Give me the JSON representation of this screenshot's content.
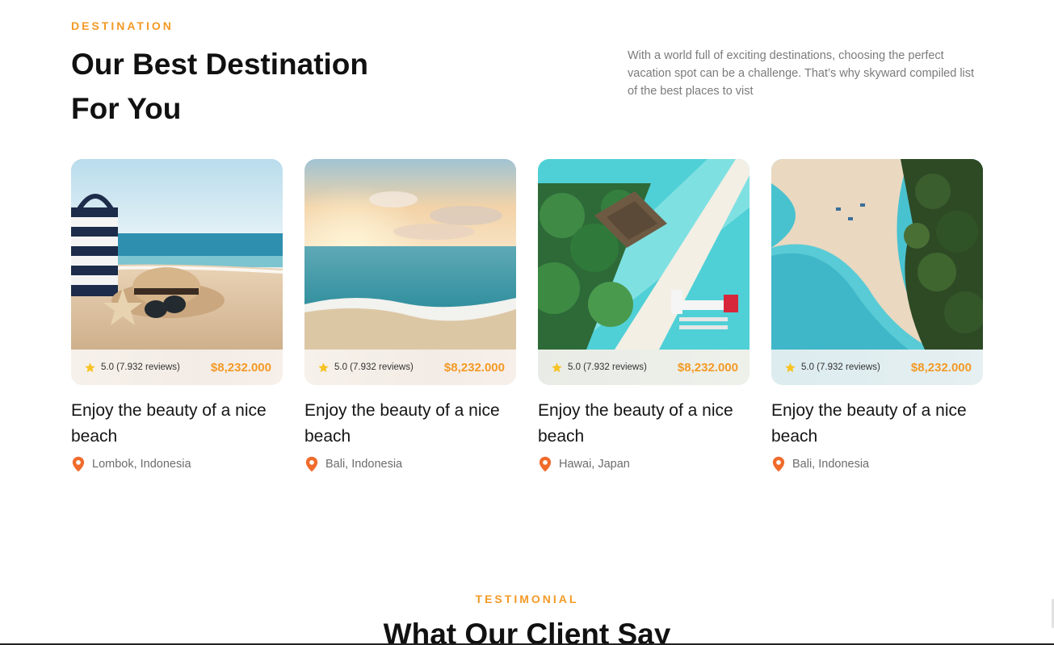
{
  "destination": {
    "eyebrow": "DESTINATION",
    "title": "Our Best Destination For You",
    "description": "With a world full of exciting destinations, choosing the perfect vacation spot can be a challenge. That’s why skyward compiled list of the best places to vist",
    "cards": [
      {
        "rating": "5.0 (7.932 reviews)",
        "price": "$8,232.000",
        "title": "Enjoy the beauty of a nice beach",
        "location": "Lombok, Indonesia"
      },
      {
        "rating": "5.0 (7.932 reviews)",
        "price": "$8,232.000",
        "title": "Enjoy the beauty of a nice beach",
        "location": "Bali, Indonesia"
      },
      {
        "rating": "5.0 (7.932 reviews)",
        "price": "$8,232.000",
        "title": "Enjoy the beauty of a nice beach",
        "location": "Hawai, Japan"
      },
      {
        "rating": "5.0 (7.932 reviews)",
        "price": "$8,232.000",
        "title": "Enjoy the beauty of a nice beach",
        "location": "Bali, Indonesia"
      }
    ]
  },
  "testimonial": {
    "eyebrow": "TESTIMONIAL",
    "title": "What Our Client Say"
  },
  "icons": {
    "rating": "star-icon",
    "location": "map-pin-icon"
  },
  "colors": {
    "accent": "#f39a26",
    "star": "#f7c325",
    "pin": "#f06b2c",
    "heading": "#111111",
    "muted": "#7b7b7b"
  }
}
